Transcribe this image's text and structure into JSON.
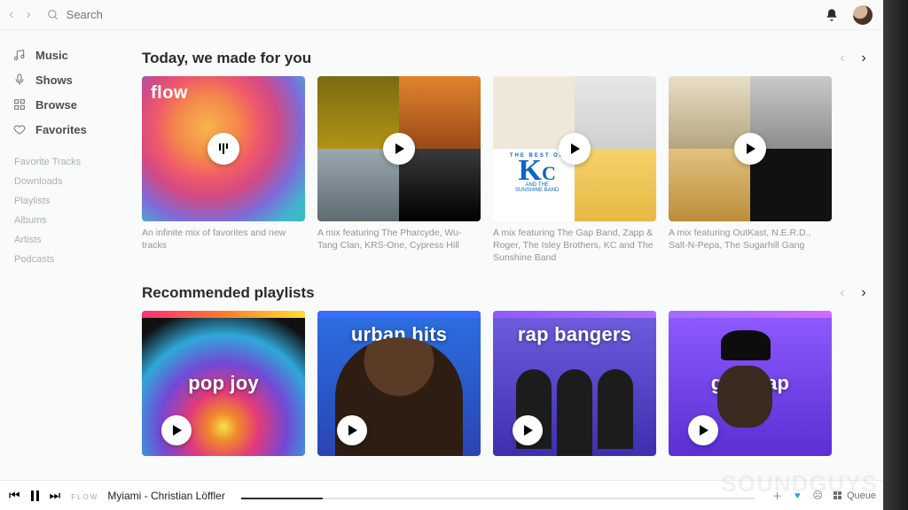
{
  "topbar": {
    "search_placeholder": "Search"
  },
  "sidebar": {
    "primary": [
      {
        "label": "Music"
      },
      {
        "label": "Shows"
      },
      {
        "label": "Browse"
      },
      {
        "label": "Favorites"
      }
    ],
    "secondary": [
      "Favorite Tracks",
      "Downloads",
      "Playlists",
      "Albums",
      "Artists",
      "Podcasts"
    ]
  },
  "sections": {
    "made_for_you": {
      "title": "Today, we made for you",
      "cards": [
        {
          "badge": "flow",
          "desc": "An infinite mix of favorites and new tracks"
        },
        {
          "desc": "A mix featuring The Pharcyde, Wu-Tang Clan, KRS-One, Cypress Hill"
        },
        {
          "kc_top": "THE BEST OF",
          "kc_mid1": "AND THE",
          "kc_mid2": "SUNSHINE BAND",
          "desc": "A mix featuring The Gap Band, Zapp & Roger, The Isley Brothers, KC and The Sunshine Band"
        },
        {
          "desc": "A mix featuring OutKast, N.E.R.D., Salt-N-Pepa, The Sugarhill Gang"
        }
      ]
    },
    "recommended": {
      "title": "Recommended playlists",
      "playlists": [
        {
          "title": "pop joy"
        },
        {
          "title": "urban hits"
        },
        {
          "title": "rap bangers"
        },
        {
          "title": "gold rap"
        }
      ]
    }
  },
  "player": {
    "flow_tag": "FLOW",
    "track_title": "Myiami - Christian Löffler",
    "queue_label": "Queue"
  }
}
